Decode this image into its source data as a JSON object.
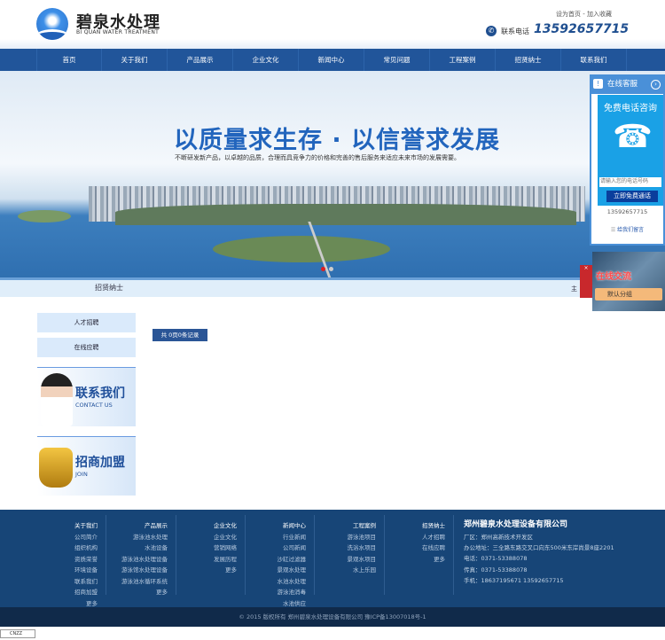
{
  "header": {
    "logo_title": "碧泉水处理",
    "logo_subtitle": "BI QUAN WATER TREATMENT",
    "toplinks": "设为首页 - 加入收藏",
    "phone_label": "联系电话",
    "phone_number": "13592657715"
  },
  "nav": [
    "首页",
    "关于我们",
    "产品展示",
    "企业文化",
    "新闻中心",
    "常见问题",
    "工程案例",
    "招贤纳士",
    "联系我们"
  ],
  "banner": {
    "title": "以质量求生存 · 以信誉求发展",
    "subtitle": "不断研发新产品，以卓越的品质，合理而具竞争力的价格和完善的售后服务来适应未来市场的发展需要。"
  },
  "subbar": {
    "title": "招贤纳士",
    "right": "主"
  },
  "sidebar": {
    "items": [
      "人才招聘",
      "在线应聘"
    ],
    "contact_title": "联系我们",
    "contact_sub": "CONTACT US",
    "join_title": "招商加盟",
    "join_sub": "JOIN"
  },
  "main": {
    "records": "共 0页0条记录"
  },
  "kefu": {
    "header": "在线客服",
    "free": "免费电话咨询",
    "input_placeholder": "请输入您的电话号码",
    "call_button": "立即免费通话",
    "number": "13592657715",
    "message": "给我们留言"
  },
  "chat": {
    "title": "在线交流",
    "group": "默认分组",
    "close": "×"
  },
  "footer": {
    "columns": [
      {
        "title": "关于我们",
        "items": [
          "公司简介",
          "组织机构",
          "资质荣誉",
          "环境设备",
          "联系我们",
          "招商加盟",
          "更多"
        ]
      },
      {
        "title": "产品展示",
        "items": [
          "游泳池水处理",
          "水池设备",
          "游泳池水处理设备",
          "游泳馆水处理设备",
          "游泳池水循环系统",
          "更多"
        ]
      },
      {
        "title": "企业文化",
        "items": [
          "企业文化",
          "营销网络",
          "发展历程",
          "更多"
        ]
      },
      {
        "title": "新闻中心",
        "items": [
          "行业新闻",
          "公司新闻",
          "沙缸过滤器",
          "景观水处理",
          "水池水处理",
          "游泳池消毒",
          "水池供应"
        ]
      },
      {
        "title": "工程案例",
        "items": [
          "游泳池项目",
          "洗浴水项目",
          "景观水项目",
          "水上乐园"
        ]
      },
      {
        "title": "招贤纳士",
        "items": [
          "人才招聘",
          "在线应聘",
          "更多"
        ]
      }
    ],
    "company": "郑州碧泉水处理设备有限公司",
    "info": [
      "厂区：郑州高新技术开发区",
      "办公地址：三全路东路交叉口向东500米东岸尚景8座2201",
      "电话：0371-53388078",
      "传真：0371-53388078",
      "手机：18637195671 13592657715"
    ],
    "copyright": "© 2015 版权所有 郑州碧泉水处理设备有限公司 豫ICP备13007018号-1",
    "cnzz": "CNZZ"
  }
}
